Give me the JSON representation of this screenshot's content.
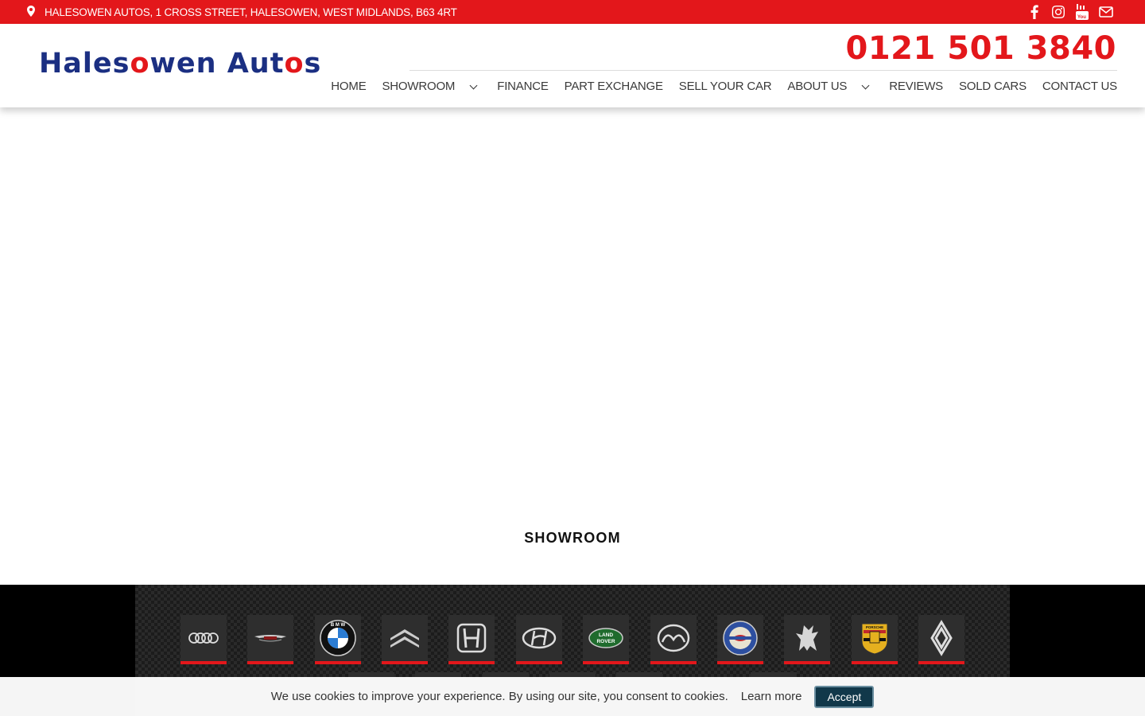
{
  "topbar": {
    "address": "HALESOWEN AUTOS, 1 CROSS STREET, HALESOWEN, WEST MIDLANDS, B63 4RT",
    "social_icons": [
      "facebook-icon",
      "instagram-icon",
      "youtube-icon",
      "envelope-icon"
    ],
    "bg_color": "#e3171b"
  },
  "header": {
    "logo_parts": [
      "Hales",
      "o",
      "wen Aut",
      "o",
      "s"
    ],
    "phone": "0121 501 3840",
    "brand_blue": "#1b2f82",
    "brand_red": "#e3171b"
  },
  "nav": {
    "items": [
      {
        "label": "HOME"
      },
      {
        "label": "SHOWROOM",
        "dropdown": true
      },
      {
        "label": "FINANCE"
      },
      {
        "label": "PART EXCHANGE"
      },
      {
        "label": "SELL YOUR CAR"
      },
      {
        "label": "ABOUT US",
        "dropdown": true
      },
      {
        "label": "REVIEWS"
      },
      {
        "label": "SOLD CARS"
      },
      {
        "label": "CONTACT US"
      }
    ]
  },
  "main": {
    "section_title": "SHOWROOM"
  },
  "brands": {
    "logos": [
      "audi-logo",
      "aston-martin-logo",
      "bmw-logo",
      "citroen-logo",
      "honda-logo",
      "hyundai-logo",
      "land-rover-logo",
      "mazda-logo",
      "morris-logo",
      "peugeot-logo",
      "porsche-logo",
      "renault-logo"
    ]
  },
  "cookie": {
    "message": "We use cookies to improve your experience. By using our site, you consent to cookies.",
    "learn_more": "Learn more",
    "accept": "Accept"
  }
}
